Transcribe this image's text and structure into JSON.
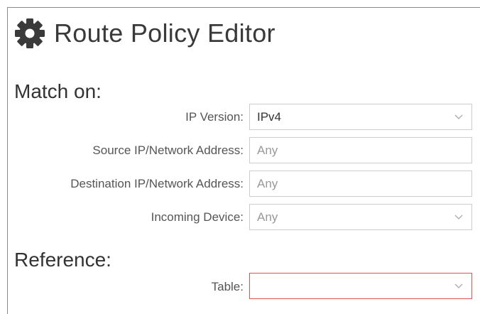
{
  "header": {
    "title": "Route Policy Editor",
    "icon": "gear-icon"
  },
  "match_section": {
    "heading": "Match on:",
    "fields": {
      "ip_version": {
        "label": "IP Version:",
        "value": "IPv4"
      },
      "source": {
        "label": "Source IP/Network Address:",
        "placeholder": "Any"
      },
      "destination": {
        "label": "Destination IP/Network Address:",
        "placeholder": "Any"
      },
      "incoming_device": {
        "label": "Incoming Device:",
        "value": "Any"
      }
    }
  },
  "reference_section": {
    "heading": "Reference:",
    "fields": {
      "table": {
        "label": "Table:",
        "value": ""
      }
    }
  },
  "colors": {
    "error_border": "#d9534f",
    "field_border": "#cccccc",
    "placeholder": "#999999"
  }
}
